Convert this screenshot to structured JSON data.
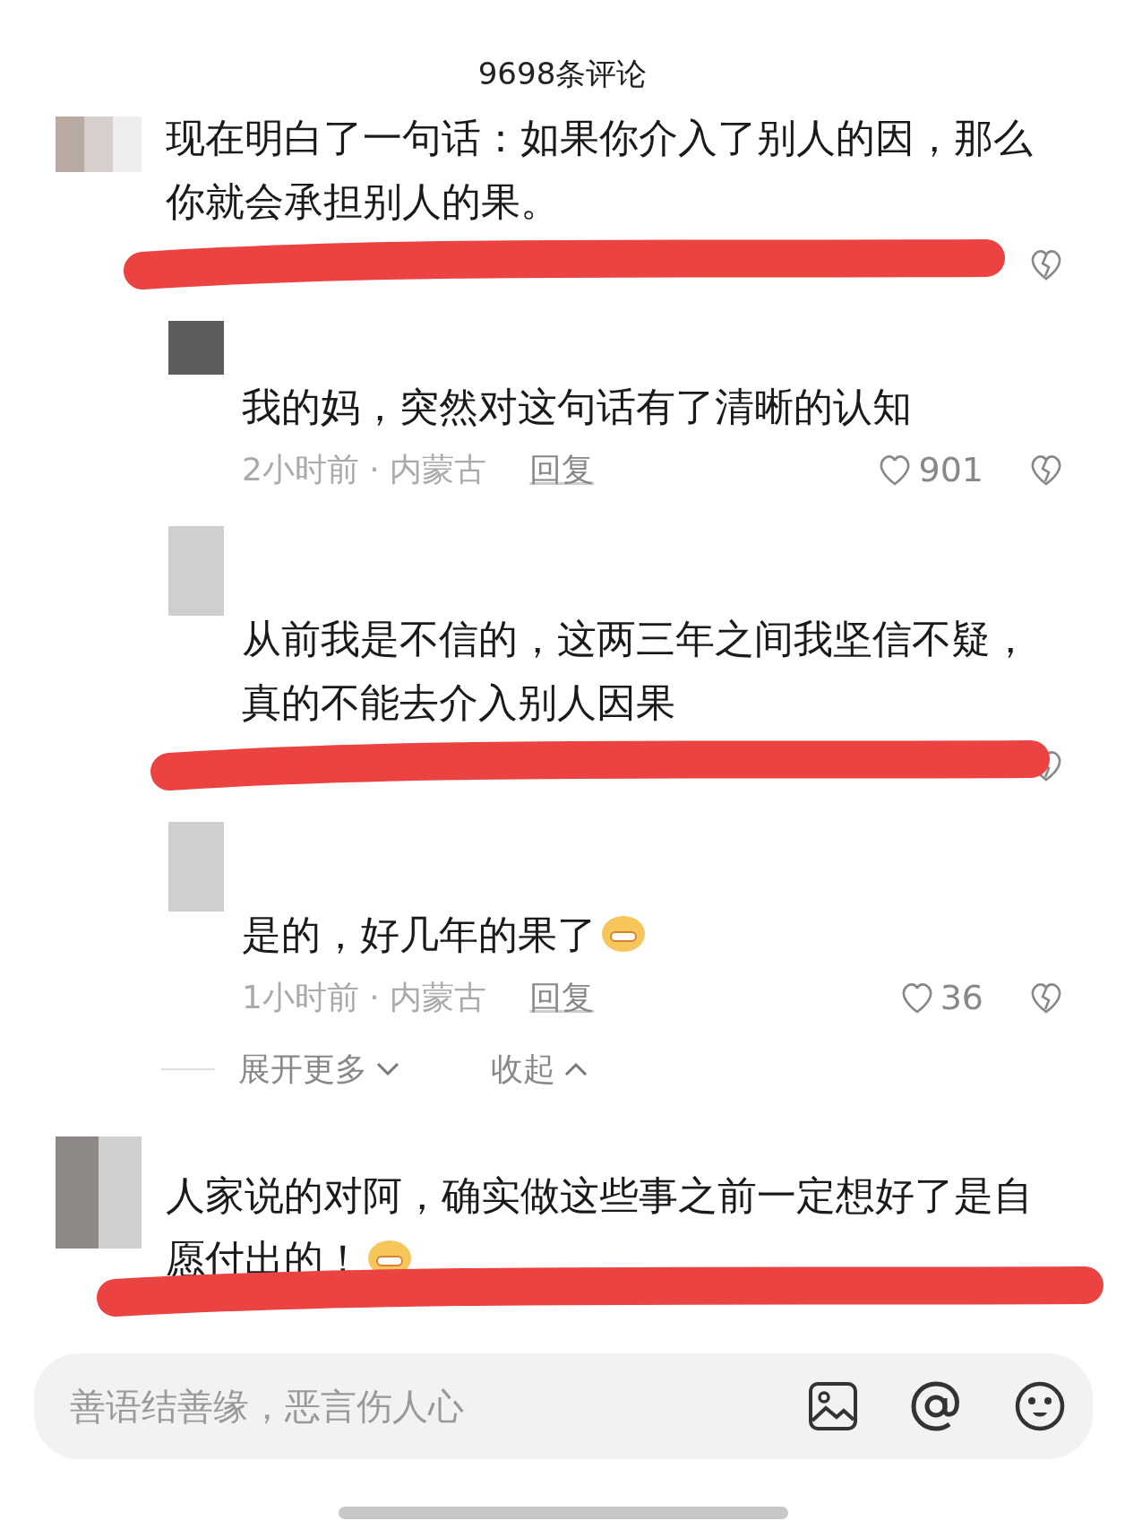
{
  "header": {
    "title": "9698条评论"
  },
  "comments": [
    {
      "text": "现在明白了一句话：如果你介入了别人的因，那么你就会承担别人的果。",
      "emoji": false,
      "redacted": true,
      "replies": [
        {
          "text": "我的妈，突然对这句话有了清晰的认知",
          "emoji": false,
          "time_location": "2小时前 · 内蒙古",
          "reply_label": "回复",
          "likes": "901",
          "redacted": false
        },
        {
          "text": "从前我是不信的，这两三年之间我坚信不疑，真的不能去介入别人因果",
          "emoji": false,
          "redacted": true
        },
        {
          "text": "是的，好几年的果了",
          "emoji": true,
          "time_location": "1小时前 · 内蒙古",
          "reply_label": "回复",
          "likes": "36",
          "redacted": false
        }
      ],
      "expand_label": "展开更多",
      "collapse_label": "收起"
    },
    {
      "text": "人家说的对阿，确实做这些事之前一定想好了是自愿付出的！",
      "emoji": true,
      "redacted": true
    }
  ],
  "input": {
    "placeholder": "善语结善缘，恶言伤人心"
  }
}
